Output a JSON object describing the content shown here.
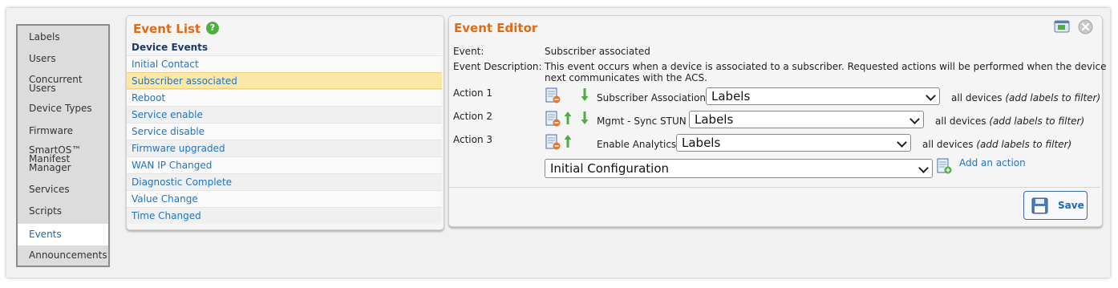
{
  "sidebar": {
    "items": [
      {
        "label": "Labels"
      },
      {
        "label": "Users"
      },
      {
        "label": "Concurrent Users"
      },
      {
        "label": "Device Types"
      },
      {
        "label": "Firmware"
      },
      {
        "label": "SmartOS™ Manifest Manager"
      },
      {
        "label": "Services"
      },
      {
        "label": "Scripts"
      },
      {
        "label": "Events",
        "active": true
      },
      {
        "label": "Announcements"
      }
    ]
  },
  "event_list": {
    "title": "Event List",
    "help_icon": "?",
    "section_header": "Device Events",
    "items": [
      "Initial Contact",
      "Subscriber associated",
      "Reboot",
      "Service enable",
      "Service disable",
      "Firmware upgraded",
      "WAN IP Changed",
      "Diagnostic Complete",
      "Value Change",
      "Time Changed"
    ],
    "selected": "Subscriber associated"
  },
  "event_editor": {
    "title": "Event Editor",
    "event_label": "Event:",
    "event_value": "Subscriber associated",
    "description_label": "Event Description:",
    "description_line1": "This event occurs when a device is associated to a subscriber. Requested actions will be performed when the device",
    "description_line2": "next communicates with the ACS.",
    "actions": [
      {
        "label": "Action 1",
        "name": "Subscriber Association",
        "select_value": "Labels",
        "scope": "all devices",
        "hint": "(add labels to filter)"
      },
      {
        "label": "Action 2",
        "name": "Mgmt - Sync STUN",
        "select_value": "Labels",
        "scope": "all devices",
        "hint": "(add labels to filter)"
      },
      {
        "label": "Action 3",
        "name": "Enable Analytics",
        "select_value": "Labels",
        "scope": "all devices",
        "hint": "(add labels to filter)"
      }
    ],
    "new_action_select": "Initial Configuration",
    "add_action_label": "Add an action",
    "save_label": "Save"
  },
  "colors": {
    "accent_title": "#e46a12",
    "link": "#1f74c0",
    "selected_row": "#fbe8a6",
    "arrow_green": "#4caf40"
  }
}
